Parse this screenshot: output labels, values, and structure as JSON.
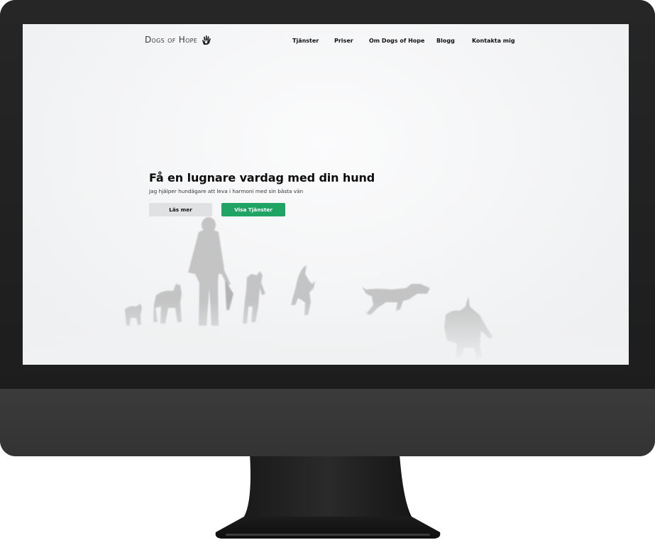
{
  "site": {
    "logo_text": "Dogs of Hope",
    "nav": [
      {
        "label": "Tjänster"
      },
      {
        "label": "Priser"
      },
      {
        "label": "Om Dogs of Hope"
      },
      {
        "label": "Blogg"
      },
      {
        "label": "Kontakta mig"
      }
    ]
  },
  "hero": {
    "title": "Få en lugnare vardag med din hund",
    "subtitle": "Jag hjälper hundägare att leva i harmoni med sin bästa vän",
    "buttons": {
      "read_more": "Läs mer",
      "show_services": "Visa Tjänster"
    }
  },
  "colors": {
    "accent": "#1fa463",
    "secondary_button": "#e0e1e3",
    "monitor": "#202020"
  },
  "icons": {
    "logo_mark": "paw-hand-icon"
  }
}
